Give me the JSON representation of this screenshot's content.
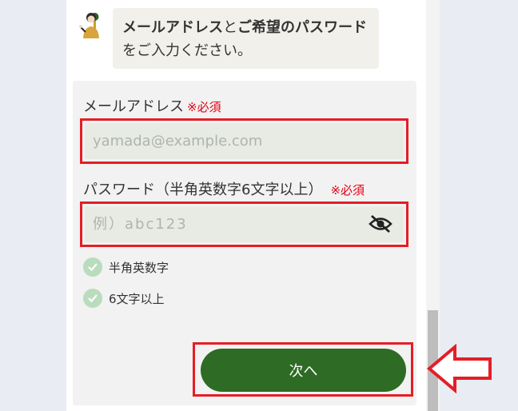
{
  "chat": {
    "message_bold_1": "メールアドレス",
    "message_normal_1": "と",
    "message_bold_2": "ご希望のパスワード",
    "message_normal_2": "をご入力ください。"
  },
  "form": {
    "email": {
      "label": "メールアドレス",
      "required": "※必須",
      "placeholder": "yamada@example.com",
      "value": ""
    },
    "password": {
      "label": "パスワード（半角英数字6文字以上）",
      "required": "※必須",
      "placeholder": "例）abc123",
      "value": ""
    },
    "checks": [
      {
        "label": "半角英数字",
        "icon": "check-circle-icon"
      },
      {
        "label": "6文字以上",
        "icon": "check-circle-icon"
      }
    ],
    "next_label": "次へ"
  },
  "colors": {
    "accent_green": "#2e6b24",
    "highlight_red": "#e41e26",
    "required_red": "#e60012",
    "check_green": "#b9dcbd"
  }
}
